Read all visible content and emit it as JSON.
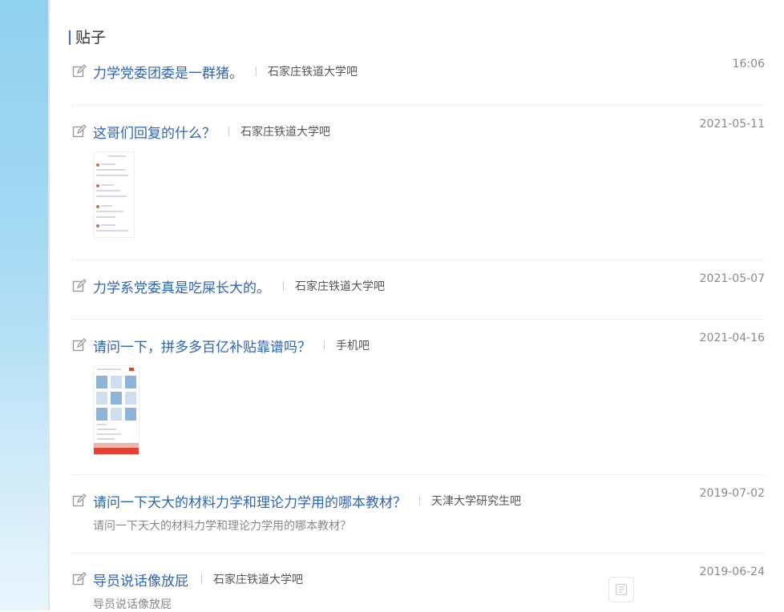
{
  "section": {
    "title": "贴子"
  },
  "posts": [
    {
      "title": "力学党委团委是一群猪。",
      "forum": "石家庄铁道大学吧",
      "time": "16:06",
      "abstract": ""
    },
    {
      "title": "这哥们回复的什么？",
      "forum": "石家庄铁道大学吧",
      "time": "2021-05-11",
      "abstract": "",
      "image": "chat-screenshot-thumbnail"
    },
    {
      "title": "力学系党委真是吃屎长大的。",
      "forum": "石家庄铁道大学吧",
      "time": "2021-05-07",
      "abstract": ""
    },
    {
      "title": "请问一下，拼多多百亿补贴靠谱吗？",
      "forum": "手机吧",
      "time": "2021-04-16",
      "abstract": "",
      "image": "shopping-app-screenshot-thumbnail"
    },
    {
      "title": "请问一下天大的材料力学和理论力学用的哪本教材？",
      "forum": "天津大学研究生吧",
      "time": "2019-07-02",
      "abstract": "请问一下天大的材料力学和理论力学用的哪本教材？"
    },
    {
      "title": "导员说话像放屁",
      "forum": "石家庄铁道大学吧",
      "time": "2019-06-24",
      "abstract": "导员说话像放屁"
    }
  ],
  "colors": {
    "link": "#2d64b3",
    "accent_bar": "#3a6fd1",
    "sidebar": "#8fd0ef"
  },
  "icons": {
    "post": "edit-icon"
  }
}
